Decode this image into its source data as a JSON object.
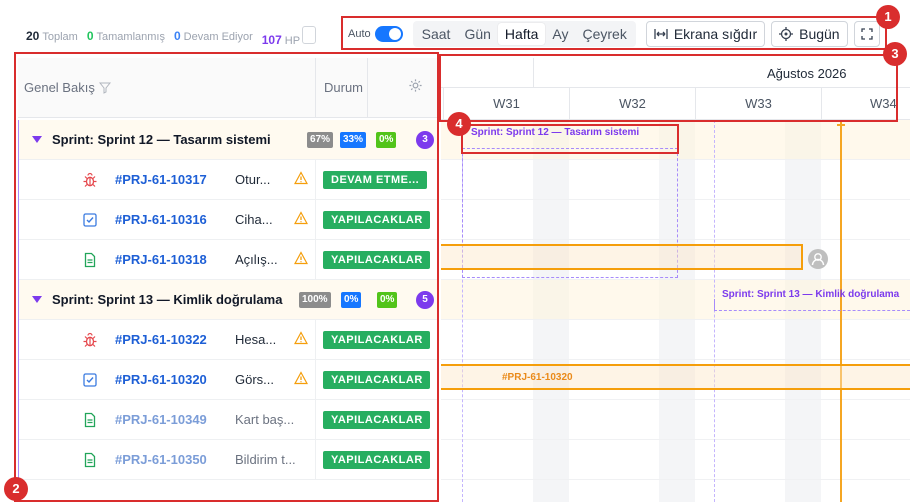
{
  "stats": {
    "total_count": "20",
    "total_label": "Toplam",
    "done_count": "0",
    "done_label": "Tamamlanmış",
    "inprogress_count": "0",
    "inprogress_label": "Devam Ediyor",
    "hp_count": "107",
    "hp_label": "HP"
  },
  "toolbar": {
    "auto_label": "Auto",
    "scales": [
      "Saat",
      "Gün",
      "Hafta",
      "Ay",
      "Çeyrek"
    ],
    "active_scale": "Hafta",
    "fit_label": "Ekrana sığdır",
    "today_label": "Bugün"
  },
  "grid": {
    "col_overview": "Genel Bakış",
    "col_status": "Durum"
  },
  "rows": [
    {
      "type": "sprint",
      "name": "Sprint: Sprint 12 — Tasarım sistemi",
      "badges": [
        "67%",
        "33%",
        "0%"
      ],
      "count": "3"
    },
    {
      "type": "task",
      "icon": "bug-icon",
      "key": "#PRJ-61-10317",
      "title": "Otur...",
      "status": "DEVAM ETME..."
    },
    {
      "type": "task",
      "icon": "checkbox-icon",
      "key": "#PRJ-61-10316",
      "title": "Ciha...",
      "status": "YAPILACAKLAR"
    },
    {
      "type": "task",
      "icon": "document-icon",
      "key": "#PRJ-61-10318",
      "title": "Açılış...",
      "status": "YAPILACAKLAR"
    },
    {
      "type": "sprint",
      "name": "Sprint: Sprint 13 — Kimlik doğrulama",
      "badges": [
        "100%",
        "0%",
        "0%"
      ],
      "count": "5"
    },
    {
      "type": "task",
      "icon": "bug-icon",
      "key": "#PRJ-61-10322",
      "title": "Hesa...",
      "status": "YAPILACAKLAR"
    },
    {
      "type": "task",
      "icon": "checkbox-icon",
      "key": "#PRJ-61-10320",
      "title": "Görs...",
      "status": "YAPILACAKLAR"
    },
    {
      "type": "task",
      "icon": "document-icon",
      "key": "#PRJ-61-10349",
      "title": "Kart baş...",
      "status": "YAPILACAKLAR",
      "muted": true
    },
    {
      "type": "task",
      "icon": "document-icon",
      "key": "#PRJ-61-10350",
      "title": "Bildirim t...",
      "status": "YAPILACAKLAR",
      "muted": true
    }
  ],
  "timeline": {
    "month_label": "Ağustos 2026",
    "weeks": [
      "W31",
      "W32",
      "W33",
      "W34"
    ],
    "sprint12_label": "Sprint: Sprint 12 — Tasarım sistemi",
    "sprint13_label": "Sprint: Sprint 13 — Kimlik doğrulama",
    "task_label": "#PRJ-61-10320"
  },
  "annotations": [
    "1",
    "2",
    "3",
    "4"
  ],
  "colors": {
    "accent": "#1677ff",
    "sprint": "#7c3aed",
    "status": "#27ae60",
    "taskbar": "#f59e0b",
    "today": "#f5a623",
    "annotation": "#d92d2d"
  }
}
